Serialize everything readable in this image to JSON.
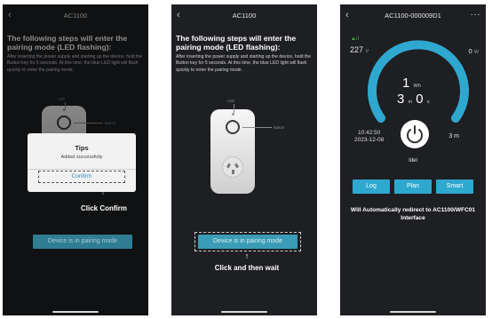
{
  "colors": {
    "accent": "#2fa8d0",
    "pair_button": "#3a9cb6",
    "phone_bg": "#1e1f22",
    "confirm_text": "#2f86b5",
    "signal": "#4caf50"
  },
  "screen1": {
    "title": "AC1100",
    "heading": "The following steps will enter the pairing mode (LED flashing):",
    "body": "After inserting the power supply and starting up the device, hold the Button key for 5 seconds. At this time, the blue LED light will flash quickly to enter the pairing mode.",
    "led_label": "LED",
    "button_label": "Button",
    "dialog": {
      "title": "Tips",
      "message": "Added successfully",
      "confirm": "Confirm"
    },
    "annotation": "Click Confirm",
    "pair_button": "Device is in pairing mode"
  },
  "screen2": {
    "title": "AC1100",
    "heading": "The following steps will enter the pairing mode (LED flashing):",
    "body": "After inserting the power supply and starting up the device, hold the Button key for 5 seconds. At this time, the blue LED light will flash quickly to enter the pairing mode.",
    "led_label": "LED",
    "button_label": "Button",
    "pair_button": "Device is in pairing mode",
    "annotation": "Click and then wait"
  },
  "screen3": {
    "title": "AC1100-000009D1",
    "more": "···",
    "voltage_value": "227",
    "voltage_unit": "V",
    "power_value": "0",
    "power_unit": "W",
    "energy_value": "1",
    "energy_unit": "Wh",
    "time_value": "3",
    "time_unit_m": "m",
    "time_value2": "0",
    "time_unit_s": "s",
    "clock_time": "10:42:50",
    "clock_date": "2023-12-08",
    "duration": "3 m",
    "state": "Idel",
    "tabs": [
      "Log",
      "Plan",
      "Smart"
    ],
    "redirect_note": "Will Automatically redirect to AC1100/WFC01 Interface"
  }
}
